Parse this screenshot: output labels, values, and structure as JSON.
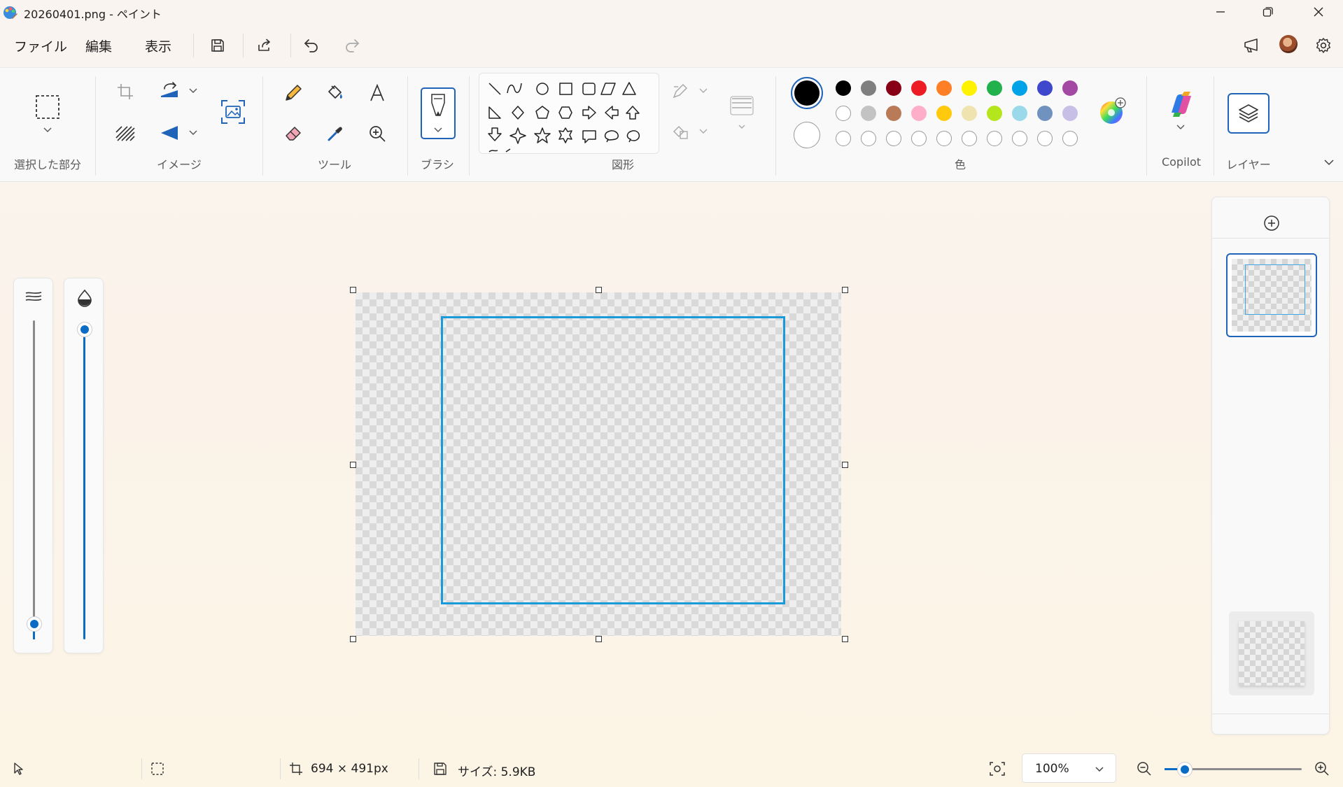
{
  "window": {
    "title": "20260401.png - ペイント"
  },
  "menu": {
    "file": "ファイル",
    "edit": "編集",
    "view": "表示"
  },
  "ribbon": {
    "groups": {
      "selection": "選択した部分",
      "image": "イメージ",
      "tools": "ツール",
      "brush": "ブラシ",
      "shapes": "図形",
      "colors": "色",
      "copilot": "Copilot",
      "layers": "レイヤー"
    }
  },
  "colors": {
    "primary": "#000000",
    "secondary": "#ffffff",
    "row1": [
      "#000000",
      "#7f7f7f",
      "#880015",
      "#ed1c24",
      "#ff7f27",
      "#fff200",
      "#22b14c",
      "#00a2e8",
      "#3f48cc",
      "#a349a4"
    ],
    "row2": [
      "#ffffff",
      "#c3c3c3",
      "#b97a57",
      "#ffaec9",
      "#ffc90e",
      "#efe4b0",
      "#b5e61d",
      "#99d9ea",
      "#7092be",
      "#c8bfe7"
    ],
    "accent": "#0a6cc4"
  },
  "status": {
    "canvas_size": "694 × 491px",
    "file_size": "サイズ: 5.9KB",
    "zoom": "100%"
  }
}
